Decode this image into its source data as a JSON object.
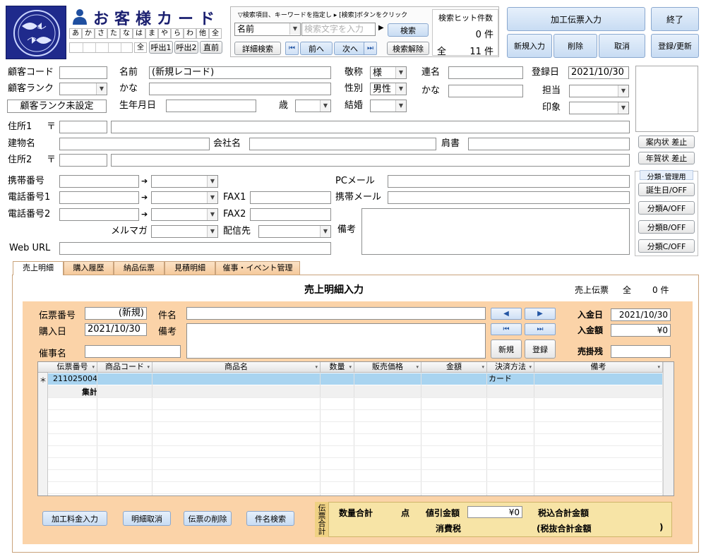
{
  "header": {
    "title": "お客様カード",
    "kana_row": [
      "あ",
      "か",
      "さ",
      "た",
      "な",
      "は",
      "ま",
      "や",
      "ら",
      "わ",
      "他",
      "全"
    ],
    "small_all_label": "全",
    "call_buttons": [
      "呼出1",
      "呼出2",
      "直前"
    ]
  },
  "search": {
    "hint": "▽検索項目、キーワードを指定し ▸ [検索]ボタンをクリック",
    "field_value": "名前",
    "keyword_placeholder": "検索文字を入力",
    "search_label": "検索",
    "detail_label": "詳細検索",
    "prev_label": "前へ",
    "next_label": "次へ",
    "clear_label": "検索解除",
    "hits_label": "検索ヒット件数",
    "hits_value": "0 件",
    "total_label": "全",
    "total_value": "11 件"
  },
  "toolbar": {
    "processed_slip": "加工伝票入力",
    "exit": "終了",
    "new": "新規入力",
    "delete": "削除",
    "cancel": "取消",
    "save": "登録/更新"
  },
  "form": {
    "customer_code_label": "顧客コード",
    "name_label": "名前",
    "name_value": "(新規レコード)",
    "honorific_label": "敬称",
    "honorific_value": "様",
    "contact_label": "連名",
    "register_date_label": "登録日",
    "register_date_value": "2021/10/30",
    "rank_label": "顧客ランク",
    "kana_label": "かな",
    "gender_label": "性別",
    "gender_value": "男性",
    "kana2_label": "かな",
    "staff_label": "担当",
    "rank_unset_label": "顧客ランク未設定",
    "birthday_label": "生年月日",
    "age_label": "歳",
    "married_label": "結婚",
    "impression_label": "印象",
    "address1_label": "住所1",
    "postal_mark": "〒",
    "building_label": "建物名",
    "company_label": "会社名",
    "title_label": "肩書",
    "address2_label": "住所2",
    "mobile_label": "携帯番号",
    "arrow": "➔",
    "pc_mail_label": "PCメール",
    "phone1_label": "電話番号1",
    "fax1_label": "FAX1",
    "mobile_mail_label": "携帯メール",
    "phone2_label": "電話番号2",
    "fax2_label": "FAX2",
    "mailmag_label": "メルマガ",
    "delivery_label": "配信先",
    "notes_label": "備考",
    "web_label": "Web URL"
  },
  "side_buttons": {
    "guide_sent": "案内状 差止",
    "newyear_sent": "年賀状 差止",
    "category_header": "分類･管理用",
    "birthday_off": "誕生日/OFF",
    "cat_a": "分類A/OFF",
    "cat_b": "分類B/OFF",
    "cat_c": "分類C/OFF"
  },
  "tabs": [
    "売上明細",
    "購入履歴",
    "納品伝票",
    "見積明細",
    "催事・イベント管理"
  ],
  "sales": {
    "title": "売上明細入力",
    "slip_label": "売上伝票",
    "slip_all": "全",
    "slip_count": "0 件",
    "slip_no_label": "伝票番号",
    "slip_no_value": "(新規)",
    "subject_label": "件名",
    "purchase_date_label": "購入日",
    "purchase_date_value": "2021/10/30",
    "notes_label": "備考",
    "event_label": "催事名",
    "new_label": "新規",
    "register_label": "登録",
    "payment_date_label": "入金日",
    "payment_date_value": "2021/10/30",
    "payment_amount_label": "入金額",
    "payment_amount_value": "¥0",
    "receivable_label": "売掛残"
  },
  "grid": {
    "columns": [
      "伝票番号",
      "商品コード",
      "商品名",
      "数量",
      "販売価格",
      "金額",
      "決済方法",
      "備考"
    ],
    "row_marker": "＊",
    "first_row": {
      "slip_no": "211025004",
      "payment": "カード"
    },
    "total_label": "集計"
  },
  "footer": {
    "btn_processing_fee": "加工料金入力",
    "btn_cancel_detail": "明細取消",
    "btn_delete_slip": "伝票の削除",
    "btn_subject_search": "件名検索",
    "slip_total_vertical": "伝票合計",
    "qty_total_label": "数量合計",
    "points_label": "点",
    "discount_label": "値引金額",
    "discount_value": "¥0",
    "tax_included_label": "税込合計金額",
    "tax_label": "消費税",
    "tax_excluded_label": "(税抜合計金額",
    "close_paren": ")"
  },
  "colors": {
    "logo_bg": "#1f2a8c",
    "orange_panel": "#fbd3a8",
    "selected_row": "#a9d4f0",
    "footer_highlight": "#f7e4a6"
  }
}
